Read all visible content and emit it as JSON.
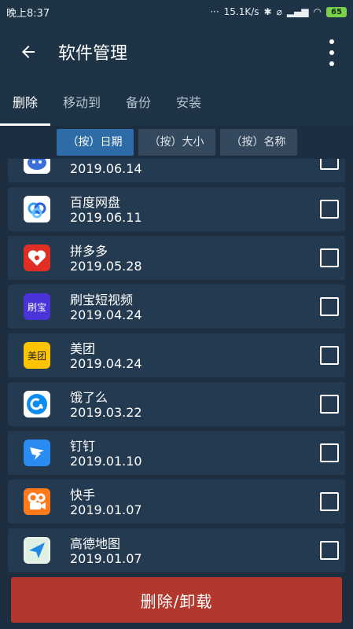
{
  "status_bar": {
    "time": "晚上8:37",
    "network_speed": "15.1K/s",
    "battery": "65"
  },
  "app_bar": {
    "title": "软件管理"
  },
  "tabs": [
    {
      "label": "删除",
      "active": true
    },
    {
      "label": "移动到",
      "active": false
    },
    {
      "label": "备份",
      "active": false
    },
    {
      "label": "安装",
      "active": false
    }
  ],
  "sort_buttons": [
    {
      "label": "（按）日期",
      "active": true
    },
    {
      "label": "（按）大小",
      "active": false
    },
    {
      "label": "（按）名称",
      "active": false
    }
  ],
  "apps": [
    {
      "name": "",
      "date": "2019.06.14",
      "icon": "cartoon-app-icon",
      "icon_color": "#3b6fd8"
    },
    {
      "name": "百度网盘",
      "date": "2019.06.11",
      "icon": "baidu-netdisk-icon",
      "icon_color": "#ffffff"
    },
    {
      "name": "拼多多",
      "date": "2019.05.28",
      "icon": "pinduoduo-icon",
      "icon_color": "#e02e24"
    },
    {
      "name": "刷宝短视频",
      "date": "2019.04.24",
      "icon": "shuabao-icon",
      "icon_color": "#4a33d8",
      "icon_text": "刷宝"
    },
    {
      "name": "美团",
      "date": "2019.04.24",
      "icon": "meituan-icon",
      "icon_color": "#ffc300",
      "icon_text": "美团"
    },
    {
      "name": "饿了么",
      "date": "2019.03.22",
      "icon": "eleme-icon",
      "icon_color": "#ffffff"
    },
    {
      "name": "钉钉",
      "date": "2019.01.10",
      "icon": "dingtalk-icon",
      "icon_color": "#2a8cf2"
    },
    {
      "name": "快手",
      "date": "2019.01.07",
      "icon": "kuaishou-icon",
      "icon_color": "#ff7a1a"
    },
    {
      "name": "高德地图",
      "date": "2019.01.07",
      "icon": "amap-icon",
      "icon_color": "#ffffff"
    }
  ],
  "action": {
    "delete_label": "删除/卸载"
  }
}
